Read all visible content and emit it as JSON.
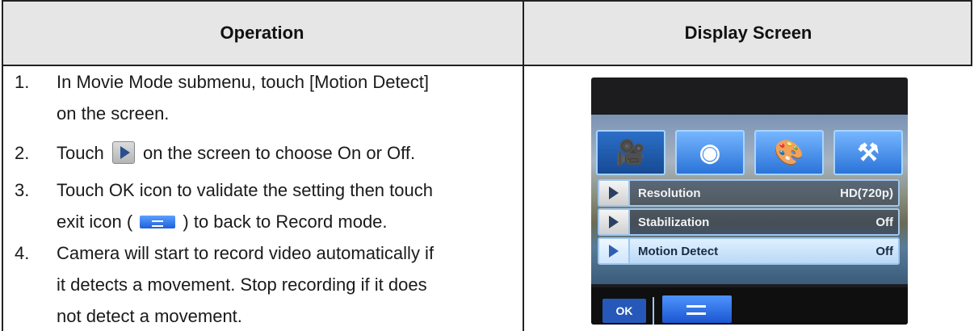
{
  "table": {
    "headers": {
      "operation": "Operation",
      "display_screen": "Display Screen"
    },
    "steps": [
      {
        "num": "1.",
        "line1": "In Movie Mode submenu, touch [Motion Detect]",
        "line2": "on the screen."
      },
      {
        "num": "2.",
        "pre": "Touch",
        "post": "on the screen to choose On or Off."
      },
      {
        "num": "3.",
        "line1": "Touch OK icon to validate the setting then touch",
        "pre2": "exit icon (",
        "post2": ") to back to Record mode."
      },
      {
        "num": "4.",
        "line1": "Camera will start to record video automatically if",
        "line2": "it detects a movement. Stop recording if it does",
        "line3": "not detect a movement."
      }
    ]
  },
  "screen": {
    "tabs": [
      {
        "icon": "movie-mode-icon",
        "glyph": "🎥"
      },
      {
        "icon": "camera-icon",
        "glyph": "◉"
      },
      {
        "icon": "palette-icon",
        "glyph": "🎨"
      },
      {
        "icon": "tools-icon",
        "glyph": "⚒"
      }
    ],
    "menu": [
      {
        "label": "Resolution",
        "value": "HD(720p)"
      },
      {
        "label": "Stabilization",
        "value": "Off"
      },
      {
        "label": "Motion Detect",
        "value": "Off"
      }
    ],
    "ok_label": "OK"
  }
}
